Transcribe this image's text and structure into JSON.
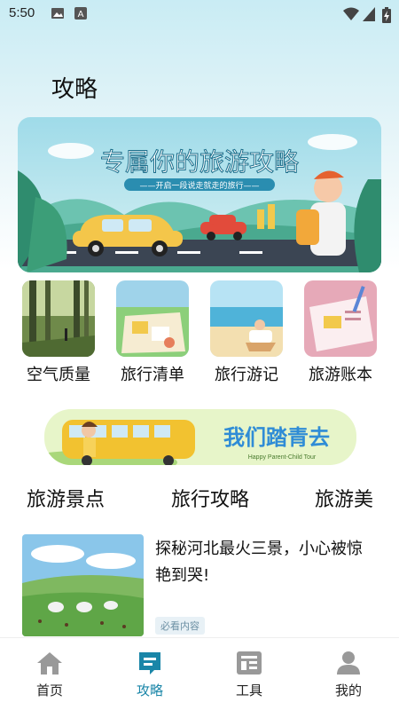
{
  "status_bar": {
    "time": "5:50"
  },
  "page_title": "攻略",
  "banner": {
    "title": "专属你的旅游攻略",
    "subtitle": "——开启一段说走就走的旅行——"
  },
  "categories": [
    {
      "label": "空气质量"
    },
    {
      "label": "旅行清单"
    },
    {
      "label": "旅行游记"
    },
    {
      "label": "旅游账本"
    }
  ],
  "promo": {
    "title": "我们踏青去",
    "subtitle": "Happy Parent-Child Tour"
  },
  "tabs": [
    {
      "label": "旅游景点"
    },
    {
      "label": "旅行攻略"
    },
    {
      "label": "旅游美"
    }
  ],
  "article": {
    "title": "探秘河北最火三景，小心被惊艳到哭!",
    "tag": "必看内容"
  },
  "bottom_nav": [
    {
      "label": "首页",
      "active": false
    },
    {
      "label": "攻略",
      "active": true
    },
    {
      "label": "工具",
      "active": false
    },
    {
      "label": "我的",
      "active": false
    }
  ],
  "colors": {
    "accent": "#1a86a8",
    "banner_bg": "#bfe6ee",
    "promo_bg": "#e7f5c9"
  }
}
